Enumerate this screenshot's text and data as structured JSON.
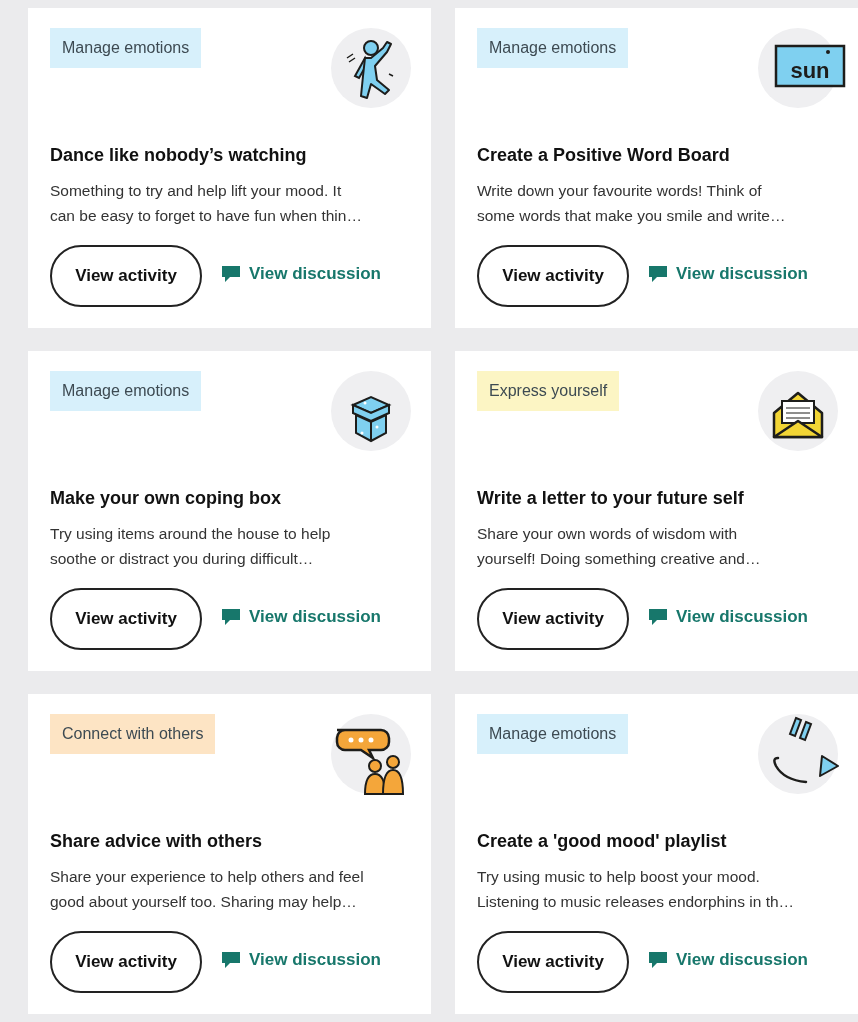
{
  "cards": [
    {
      "tag": {
        "label": "Manage emotions",
        "color": "#d7f0fb"
      },
      "icon": {
        "kind": "dancer"
      },
      "title": "Dance like nobody’s watching",
      "description_lines": [
        "Something to try and help lift your mood. It",
        "can be easy to forget to have fun when thin…"
      ],
      "primary_button": "View activity",
      "link": "View discussion"
    },
    {
      "tag": {
        "label": "Manage emotions",
        "color": "#d7f0fb"
      },
      "icon": {
        "kind": "sign",
        "text": "sun"
      },
      "title": "Create a Positive Word Board",
      "description_lines": [
        "Write down your favourite words! Think of",
        "some words that make you smile and write…"
      ],
      "primary_button": "View activity",
      "link": "View discussion"
    },
    {
      "tag": {
        "label": "Manage emotions",
        "color": "#d7f0fb"
      },
      "icon": {
        "kind": "box"
      },
      "title": "Make your own coping box",
      "description_lines": [
        "Try using items around the house to help",
        "soothe or distract you during difficult…"
      ],
      "primary_button": "View activity",
      "link": "View discussion"
    },
    {
      "tag": {
        "label": "Express yourself",
        "color": "#fcf5c4"
      },
      "icon": {
        "kind": "envelope"
      },
      "title": "Write a letter to your future self",
      "description_lines": [
        "Share your own words of wisdom with",
        "yourself! Doing something creative and…"
      ],
      "primary_button": "View activity",
      "link": "View discussion"
    },
    {
      "tag": {
        "label": "Connect with others",
        "color": "#fde4c4"
      },
      "icon": {
        "kind": "chat"
      },
      "title": "Share advice with others",
      "description_lines": [
        "Share your experience to help others and feel",
        "good about yourself too. Sharing may help…"
      ],
      "primary_button": "View activity",
      "link": "View discussion"
    },
    {
      "tag": {
        "label": "Manage emotions",
        "color": "#d7f0fb"
      },
      "icon": {
        "kind": "smiley"
      },
      "title": "Create a 'good mood' playlist",
      "description_lines": [
        "Try using music to help boost your mood.",
        "Listening to music releases endorphins in th…"
      ],
      "primary_button": "View activity",
      "link": "View discussion"
    }
  ]
}
